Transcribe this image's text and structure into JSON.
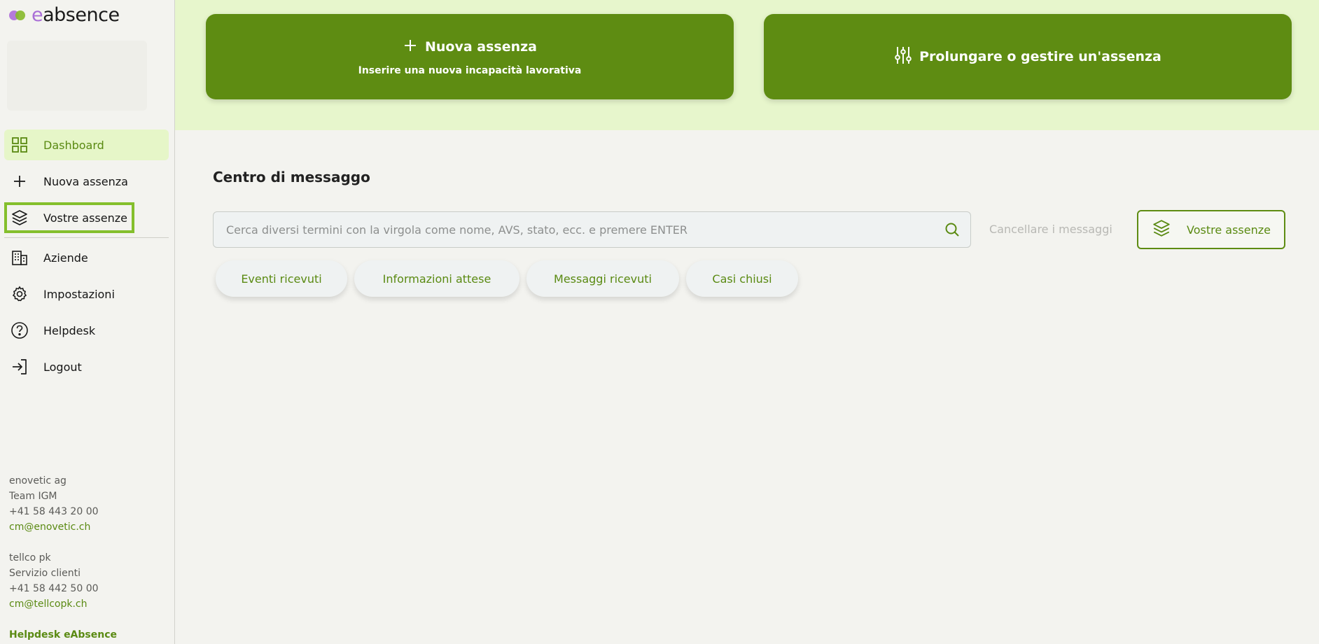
{
  "brand": {
    "prefix": "e",
    "rest": "absence"
  },
  "sidebar": {
    "items": [
      {
        "label": "Dashboard",
        "icon": "grid-icon"
      },
      {
        "label": "Nuova assenza",
        "icon": "plus-icon"
      },
      {
        "label": "Vostre assenze",
        "icon": "layers-icon"
      },
      {
        "label": "Aziende",
        "icon": "building-icon"
      },
      {
        "label": "Impostazioni",
        "icon": "gear-icon"
      },
      {
        "label": "Helpdesk",
        "icon": "question-icon"
      },
      {
        "label": "Logout",
        "icon": "logout-icon"
      }
    ],
    "contacts": [
      {
        "company": "enovetic ag",
        "team": "Team IGM",
        "phone": "+41 58 443 20 00",
        "email": "cm@enovetic.ch"
      },
      {
        "company": "tellco pk",
        "team": "Servizio clienti",
        "phone": "+41 58 442 50 00",
        "email": "cm@tellcopk.ch"
      }
    ],
    "helpdesk_link": "Helpdesk eAbsence"
  },
  "hero": {
    "new_title": "Nuova assenza",
    "new_subtitle": "Inserire una nuova incapacità lavorativa",
    "manage_title": "Prolungare o gestire un'assenza"
  },
  "messages": {
    "title": "Centro di messaggo",
    "search_placeholder": "Cerca diversi termini con la virgola come nome, AVS, stato, ecc. e premere ENTER",
    "clear_label": "Cancellare i messaggi",
    "yours_label": "Vostre assenze",
    "chips": [
      "Eventi ricevuti",
      "Informazioni attese",
      "Messaggi ricevuti",
      "Casi chiusi"
    ]
  },
  "colors": {
    "accent": "#5e8c12",
    "hero_bg": "#e7f6cc",
    "highlight": "#84bf2c",
    "purple": "#a96ed6"
  }
}
